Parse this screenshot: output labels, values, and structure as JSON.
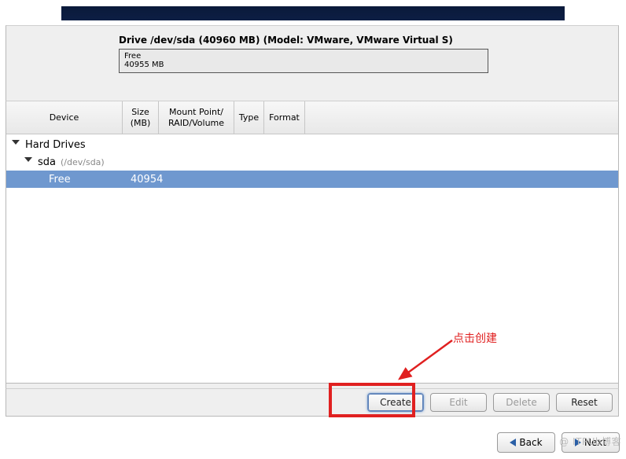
{
  "drive": {
    "title": "Drive /dev/sda (40960 MB) (Model: VMware, VMware Virtual S)",
    "segment_label": "Free",
    "segment_size": "40955 MB"
  },
  "columns": {
    "device": "Device",
    "size_line1": "Size",
    "size_line2": "(MB)",
    "mount_line1": "Mount Point/",
    "mount_line2": "RAID/Volume",
    "type": "Type",
    "format": "Format"
  },
  "tree": {
    "hard_drives": "Hard Drives",
    "sda_label": "sda",
    "sda_path": "(/dev/sda)",
    "free_label": "Free",
    "free_size": "40954"
  },
  "buttons": {
    "create": "Create",
    "edit": "Edit",
    "delete": "Delete",
    "reset": "Reset",
    "back": "Back",
    "next": "Next"
  },
  "annotation": {
    "text": "点击创建"
  },
  "watermark": "@ ITPUb博客"
}
